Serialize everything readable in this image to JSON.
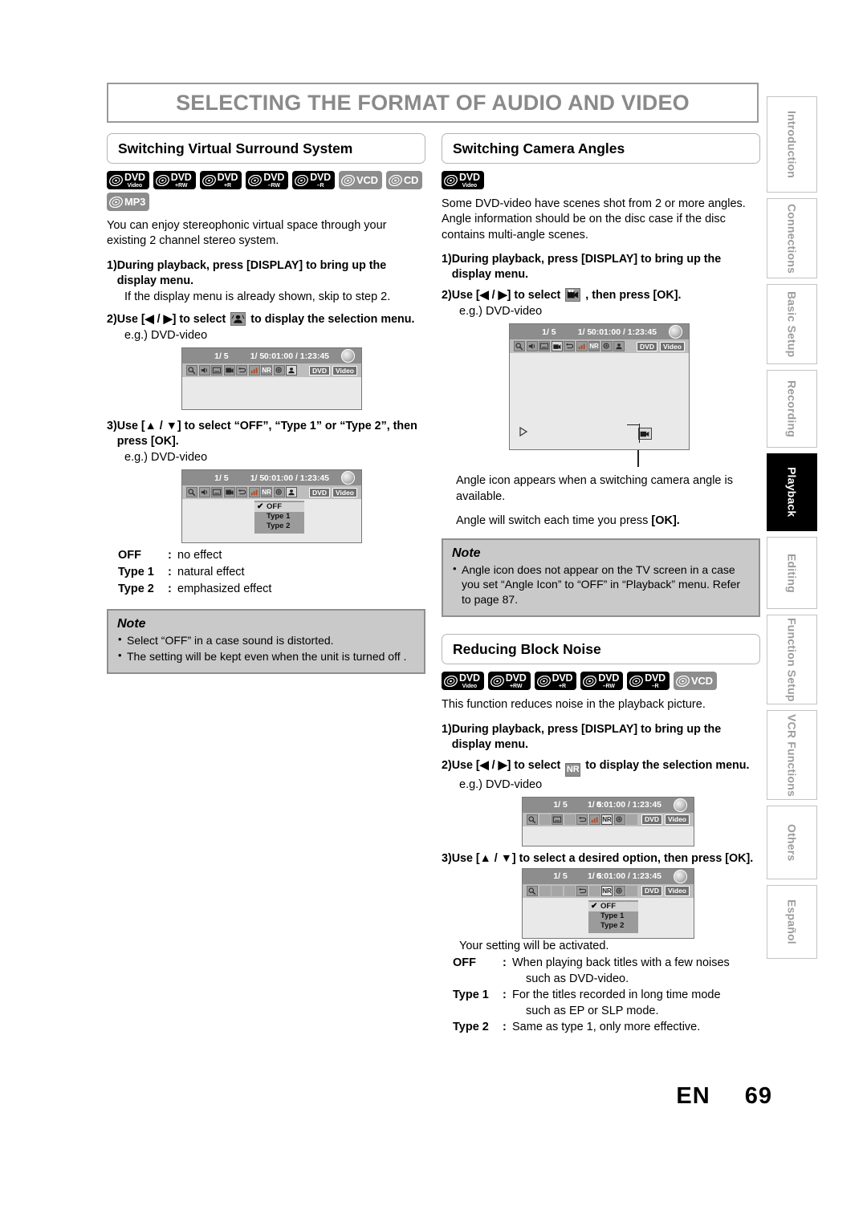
{
  "page": {
    "title": "SELECTING THE FORMAT OF AUDIO AND VIDEO",
    "footer_lang": "EN",
    "footer_number": "69"
  },
  "sidebar": {
    "tabs": [
      {
        "label": "Introduction",
        "active": false
      },
      {
        "label": "Connections",
        "active": false
      },
      {
        "label": "Basic Setup",
        "active": false
      },
      {
        "label": "Recording",
        "active": false
      },
      {
        "label": "Playback",
        "active": true
      },
      {
        "label": "Editing",
        "active": false
      },
      {
        "label": "Function Setup",
        "active": false
      },
      {
        "label": "VCR Functions",
        "active": false
      },
      {
        "label": "Others",
        "active": false
      },
      {
        "label": "Español",
        "active": false
      }
    ]
  },
  "screen_labels": {
    "field1": "1/  5",
    "field2": "1/  5",
    "time": "0:01:00 / 1:23:45",
    "tag_disc": "DVD",
    "tag_format": "Video",
    "options": [
      "OFF",
      "Type 1",
      "Type 2"
    ],
    "selected_option": "OFF",
    "check_mark": "✔"
  },
  "sections": {
    "surround": {
      "heading": "Switching Virtual Surround System",
      "badges": [
        {
          "top": "DVD",
          "bottom": "Video",
          "style": "black"
        },
        {
          "top": "DVD",
          "bottom": "+RW",
          "style": "black"
        },
        {
          "top": "DVD",
          "bottom": "+R",
          "style": "black"
        },
        {
          "top": "DVD",
          "bottom": "–RW",
          "style": "black"
        },
        {
          "top": "DVD",
          "bottom": "–R",
          "style": "black"
        },
        {
          "top": "VCD",
          "bottom": "",
          "style": "gray"
        },
        {
          "top": "CD",
          "bottom": "",
          "style": "gray"
        },
        {
          "top": "MP3",
          "bottom": "",
          "style": "gray"
        }
      ],
      "intro": "You can enjoy stereophonic virtual space through your existing 2 channel stereo system.",
      "step1_num": "1)",
      "step1": "During playback, press [DISPLAY] to bring up the display menu.",
      "step1_sub": "If the display menu is already shown, skip to step 2.",
      "step2_num": "2)",
      "step2_a": "Use [◀ / ▶] to select",
      "step2_b": "to display the selection menu.",
      "step2_sub": "e.g.) DVD-video",
      "step3_num": "3)",
      "step3": "Use [▲ / ▼] to select “OFF”, “Type 1” or “Type 2”, then press [OK].",
      "step3_sub": "e.g.) DVD-video",
      "definitions": [
        {
          "term": "OFF",
          "desc": "no effect"
        },
        {
          "term": "Type 1",
          "desc": "natural effect"
        },
        {
          "term": "Type 2",
          "desc": "emphasized effect"
        }
      ],
      "note_title": "Note",
      "note_items": [
        "Select “OFF” in a case sound is distorted.",
        "The setting will be kept even when the unit is turned off  ."
      ]
    },
    "camera_angles": {
      "heading": "Switching Camera Angles",
      "badges": [
        {
          "top": "DVD",
          "bottom": "Video",
          "style": "black"
        }
      ],
      "intro": "Some DVD-video have scenes shot from 2 or more angles. Angle information should be on the disc case if the disc contains multi-angle scenes.",
      "step1_num": "1)",
      "step1": "During playback, press [DISPLAY] to bring up the display menu.",
      "step2_num": "2)",
      "step2_a": "Use [◀ / ▶] to select",
      "step2_b": ", then press [OK].",
      "step2_sub": "e.g.) DVD-video",
      "after1": "Angle icon appears when a switching camera angle is available.",
      "after2_a": "Angle will switch each time you press",
      "after2_b": "[OK].",
      "note_title": "Note",
      "note_items": [
        "Angle icon does not appear on the TV screen in a case you set “Angle Icon” to “OFF” in “Playback” menu. Refer to page 87."
      ]
    },
    "block_noise": {
      "heading": "Reducing Block Noise",
      "badges": [
        {
          "top": "DVD",
          "bottom": "Video",
          "style": "black"
        },
        {
          "top": "DVD",
          "bottom": "+RW",
          "style": "black"
        },
        {
          "top": "DVD",
          "bottom": "+R",
          "style": "black"
        },
        {
          "top": "DVD",
          "bottom": "–RW",
          "style": "black"
        },
        {
          "top": "DVD",
          "bottom": "–R",
          "style": "black"
        },
        {
          "top": "VCD",
          "bottom": "",
          "style": "gray"
        }
      ],
      "intro": "This function reduces noise in the playback picture.",
      "step1_num": "1)",
      "step1": "During playback, press [DISPLAY] to bring up the display menu.",
      "step2_num": "2)",
      "step2_a": "Use [◀ / ▶] to select",
      "step2_b": "to display the selection menu.",
      "step2_icon_label": "NR",
      "step2_sub": "e.g.) DVD-video",
      "step3_num": "3)",
      "step3": "Use [▲ / ▼] to select a desired option, then press [OK].",
      "activated": "Your setting will be activated.",
      "definitions": [
        {
          "term": "OFF",
          "desc": "When playing back titles with a few noises",
          "cont": "such as DVD-video."
        },
        {
          "term": "Type 1",
          "desc": "For the titles recorded in long time mode",
          "cont": "such as EP or SLP mode."
        },
        {
          "term": "Type 2",
          "desc": "Same as type 1, only more effective.",
          "cont": ""
        }
      ]
    }
  }
}
